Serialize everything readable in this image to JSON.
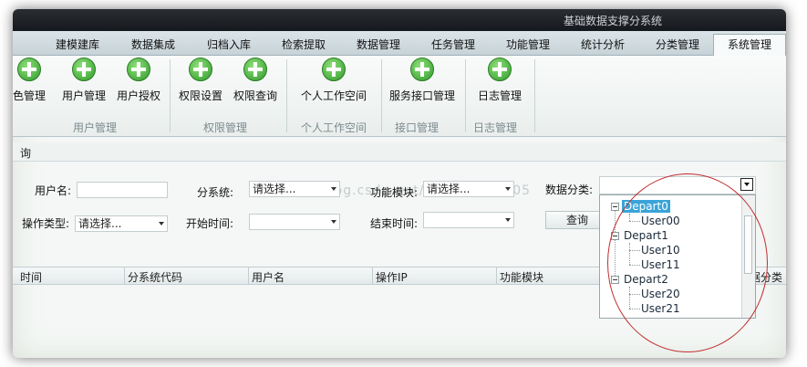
{
  "window": {
    "title": "基础数据支撑分系统"
  },
  "tabs": [
    "建模建库",
    "数据集成",
    "归档入库",
    "检索提取",
    "数据管理",
    "任务管理",
    "功能管理",
    "统计分析",
    "分类管理",
    "系统管理"
  ],
  "ribbon": {
    "buttons": [
      "色管理",
      "用户管理",
      "用户授权",
      "权限设置",
      "权限查询",
      "个人工作空间",
      "服务接口管理",
      "日志管理"
    ],
    "groups": [
      "用户管理",
      "权限管理",
      "个人工作空间",
      "接口管理",
      "日志管理"
    ]
  },
  "section": {
    "title": "询"
  },
  "form": {
    "username_label": "用户名:",
    "subsystem_label": "分系统:",
    "subsystem_value": "请选择...",
    "module_label": "功能模块:",
    "module_value": "请选择...",
    "category_label": "数据分类:",
    "optype_label": "操作类型:",
    "optype_value": "请选择...",
    "start_label": "开始时间:",
    "end_label": "结束时间:",
    "query_button": "查询"
  },
  "grid": {
    "columns": [
      "时间",
      "分系统代码",
      "用户名",
      "操作IP",
      "功能模块",
      "据分类"
    ]
  },
  "tree": {
    "nodes": [
      {
        "label": "Depart0",
        "children": [
          "User00"
        ]
      },
      {
        "label": "Depart1",
        "children": [
          "User10",
          "User11"
        ]
      },
      {
        "label": "Depart2",
        "children": [
          "User20",
          "User21"
        ]
      }
    ]
  },
  "watermark": "http://blog.csdn.net/pengzhen8805"
}
